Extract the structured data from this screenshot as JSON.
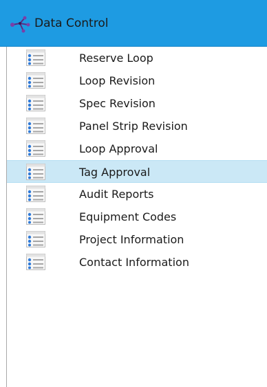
{
  "panel": {
    "title": "Data Control",
    "icon": "network-icon",
    "accent_color": "#1e9be2",
    "selected_color": "#cbe8f6"
  },
  "nav": {
    "items": [
      {
        "label": "Reserve Loop",
        "icon": "list-icon",
        "selected": false
      },
      {
        "label": "Loop Revision",
        "icon": "list-icon",
        "selected": false
      },
      {
        "label": "Spec Revision",
        "icon": "list-icon",
        "selected": false
      },
      {
        "label": "Panel Strip Revision",
        "icon": "list-icon",
        "selected": false
      },
      {
        "label": "Loop Approval",
        "icon": "list-icon",
        "selected": false
      },
      {
        "label": "Tag Approval",
        "icon": "list-icon",
        "selected": true
      },
      {
        "label": "Audit Reports",
        "icon": "list-icon",
        "selected": false
      },
      {
        "label": "Equipment Codes",
        "icon": "list-icon",
        "selected": false
      },
      {
        "label": "Project Information",
        "icon": "list-icon",
        "selected": false
      },
      {
        "label": "Contact Information",
        "icon": "list-icon",
        "selected": false
      }
    ]
  }
}
